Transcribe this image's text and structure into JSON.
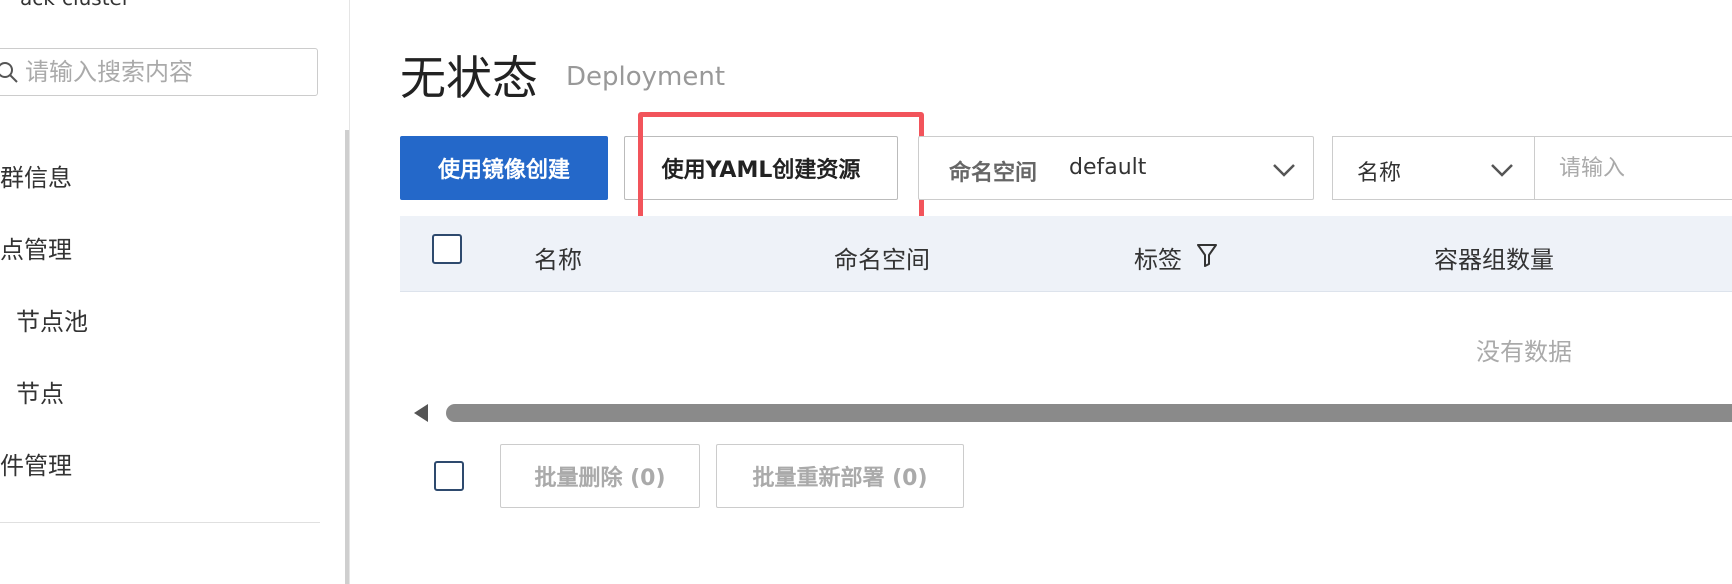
{
  "sidebar": {
    "cluster_title": "ack-cluster",
    "search_placeholder": "请输入搜索内容",
    "items": [
      {
        "label": "群信息"
      },
      {
        "label": "点管理"
      },
      {
        "label": "节点池"
      },
      {
        "label": "节点"
      },
      {
        "label": "件管理"
      }
    ]
  },
  "header": {
    "title": "无状态",
    "subtitle": "Deployment"
  },
  "toolbar": {
    "create_by_image_label": "使用镜像创建",
    "create_by_yaml_label": "使用YAML创建资源",
    "namespace_label": "命名空间",
    "namespace_value": "default",
    "filter_field_value": "名称",
    "filter_input_placeholder": "请输入"
  },
  "table": {
    "columns": [
      "名称",
      "命名空间",
      "标签",
      "容器组数量"
    ],
    "empty_text": "没有数据"
  },
  "batch_actions": {
    "delete_label": "批量删除 (0)",
    "redeploy_label": "批量重新部署 (0)"
  },
  "colors": {
    "primary": "#2468c9",
    "highlight": "#f2545b"
  }
}
